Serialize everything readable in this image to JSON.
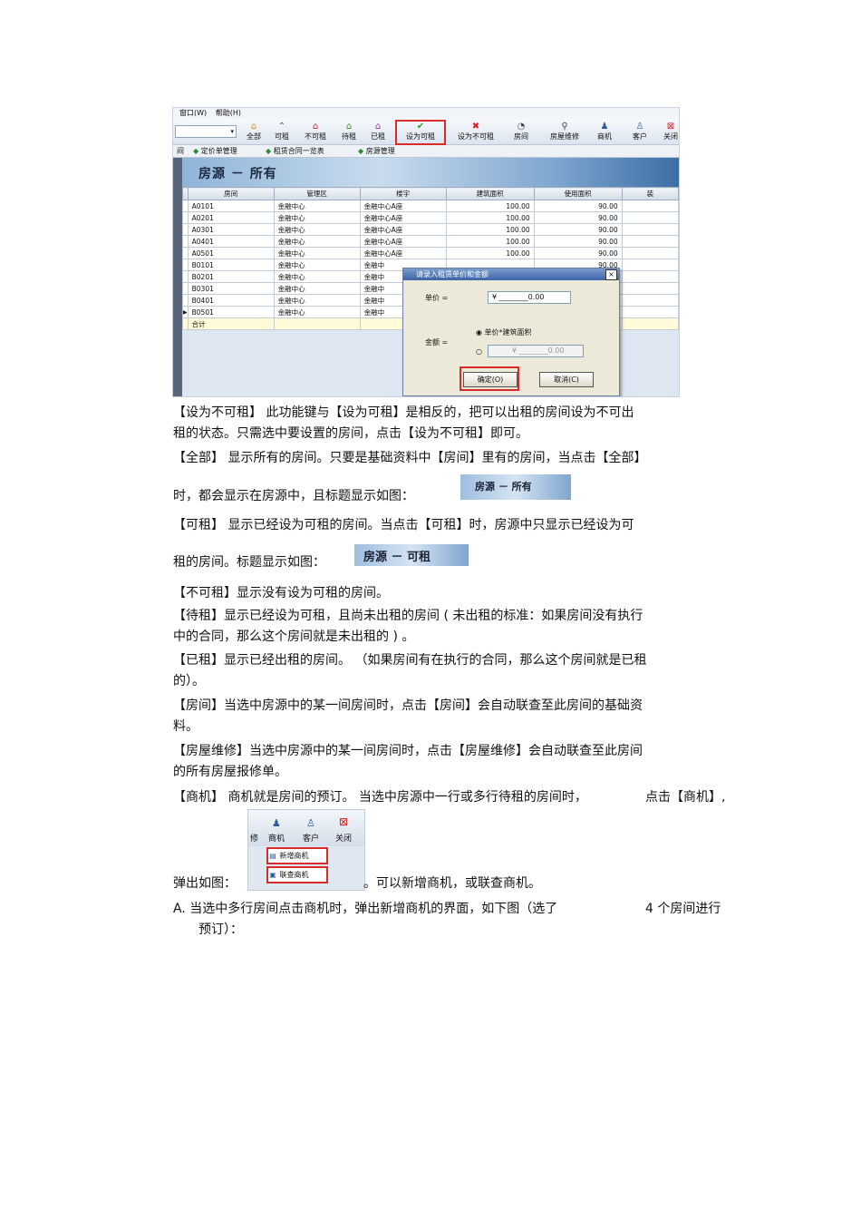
{
  "screenshot": {
    "menu": [
      "窗口(W)",
      "帮助(H)"
    ],
    "toolbar": [
      {
        "label": "全部",
        "icon": "house-icon"
      },
      {
        "label": "可租",
        "icon": "roof-icon"
      },
      {
        "label": "不可租",
        "icon": "house-red-icon"
      },
      {
        "label": "待租",
        "icon": "house-green-icon"
      },
      {
        "label": "已租",
        "icon": "house-purple-icon"
      },
      {
        "label": "设为可租",
        "icon": "check-icon"
      },
      {
        "label": "设为不可租",
        "icon": "cross-icon"
      },
      {
        "label": "房间",
        "icon": "room-icon"
      },
      {
        "label": "房屋维修",
        "icon": "magnifier-icon"
      },
      {
        "label": "商机",
        "icon": "people-icon"
      },
      {
        "label": "客户",
        "icon": "person-icon"
      },
      {
        "label": "关闭",
        "icon": "close-icon"
      }
    ],
    "tabs": [
      "间",
      "定价单管理",
      "租赁合同一览表",
      "房源管理"
    ],
    "banner_title": "房源 － 所有",
    "columns": [
      "房间",
      "管理区",
      "楼宇",
      "建筑面积",
      "使用面积",
      "装"
    ],
    "rows": [
      [
        "A0101",
        "金融中心",
        "金融中心A座",
        "100.00",
        "90.00"
      ],
      [
        "A0201",
        "金融中心",
        "金融中心A座",
        "100.00",
        "90.00"
      ],
      [
        "A0301",
        "金融中心",
        "金融中心A座",
        "100.00",
        "90.00"
      ],
      [
        "A0401",
        "金融中心",
        "金融中心A座",
        "100.00",
        "90.00"
      ],
      [
        "A0501",
        "金融中心",
        "金融中心A座",
        "100.00",
        "90.00"
      ],
      [
        "B0101",
        "金融中心",
        "金融中",
        "",
        "90.00"
      ],
      [
        "B0201",
        "金融中心",
        "金融中",
        "",
        "90.00"
      ],
      [
        "B0301",
        "金融中心",
        "金融中",
        "",
        "90.00"
      ],
      [
        "B0401",
        "金融中心",
        "金融中",
        "",
        "90.00"
      ],
      [
        "B0501",
        "金融中心",
        "金融中",
        "",
        "90.00"
      ]
    ],
    "total_label": "合计",
    "dialog": {
      "title": "请录入租赁单价和金额",
      "price_label": "单价 =",
      "price_value": "¥ ________0.00",
      "amount_label": "金额 =",
      "radio1": "单价*建筑面积",
      "amount_value": "¥ ________0.00",
      "ok": "确定(O)",
      "cancel": "取消(C)"
    }
  },
  "text": {
    "l1": "【设为不可租】     此功能键与【设为可租】是相反的，把可以出租的房间设为不可出",
    "l2": "租的状态。只需选中要设置的房间，点击【设为不可租】即可。",
    "l3": "【全部】     显示所有的房间。只要是基础资料中【房间】里有的房间，当点击【全部】",
    "l4": "时，都会显示在房源中，且标题显示如图：",
    "l5": "【可租】     显示已经设为可租的房间。当点击【可租】时，房源中只显示已经设为可",
    "l6": "租的房间。标题显示如图：",
    "l7": "【不可租】显示没有设为可租的房间。",
    "l8": "【待租】显示已经设为可租，且尚未出租的房间          ( 未出租的标准：如果房间没有执行",
    "l9": "中的合同，那么这个房间就是未出租的        ) 。",
    "l10": "【已租】显示已经出租的房间。      （如果房间有在执行的合同，那么这个房间就是已租",
    "l11": "的）。",
    "l12": "【房间】当选中房源中的某一间房间时，点击【房间】会自动联查至此房间的基础资",
    "l13": "料。",
    "l14": "【房屋维修】当选中房源中的某一间房间时，点击【房屋维修】会自动联查至此房间",
    "l15": "的所有房屋报修单。",
    "l16a": "【商机】 商机就是房间的预订。    当选中房源中一行或多行待租的房间时，",
    "l16b": "点击【商机】,",
    "l17a": "弹出如图：",
    "l17b": "。可以新增商机，或联查商机。",
    "l18a": "A.   当选中多行房间点击商机时，弹出新增商机的界面，如下图（选了",
    "l18b": "4 个房间进行",
    "l19": "预订）："
  },
  "title_images": {
    "all": "房源 － 所有",
    "rentable": "房源 － 可租"
  },
  "popup": {
    "toolbar": [
      "修",
      "商机",
      "客户",
      "关闭"
    ],
    "items": [
      "新增商机",
      "联查商机"
    ]
  },
  "colors": {
    "highlight": "#d92b2b",
    "banner": "#7ea6cf"
  }
}
